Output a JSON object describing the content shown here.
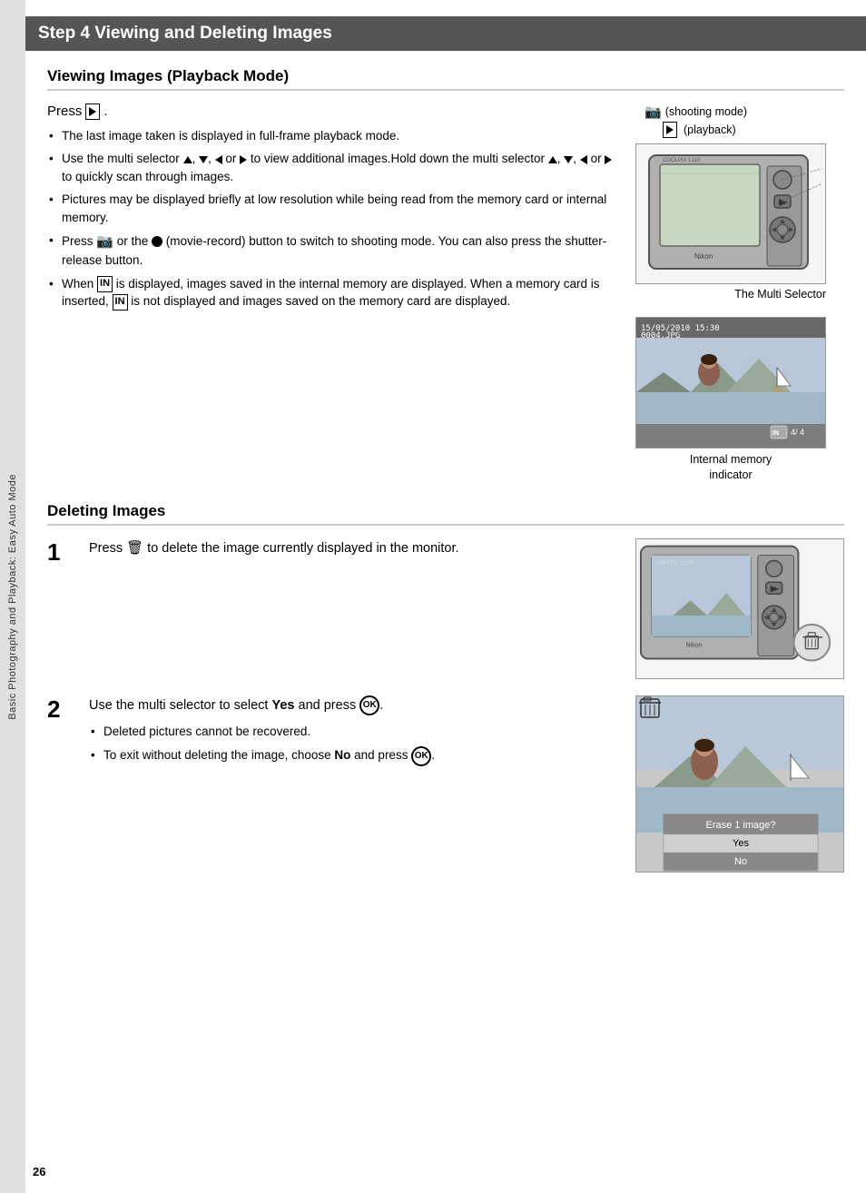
{
  "page_number": "26",
  "sidebar_text": "Basic Photography and Playback: Easy Auto Mode",
  "step_header": "Step 4 Viewing and Deleting Images",
  "section1_header": "Viewing Images (Playback Mode)",
  "press_label": "Press",
  "playback_icon_label": "▶",
  "bullet1": "The last image taken is displayed in full-frame playback mode.",
  "bullet2_pre": "Use the multi selector ",
  "bullet2_icons": "▲, ▼, ◄ or ►",
  "bullet2_mid": " to view additional images.Hold down the multi selector ",
  "bullet2_icons2": "▲, ▼, ◄ or ►",
  "bullet2_post": " to quickly scan through images.",
  "bullet3": "Pictures may be displayed briefly at low resolution while being read from the memory card or internal memory.",
  "bullet4_pre": "Press ",
  "bullet4_post": " or the  (movie-record) button to switch to shooting mode. You can also press the shutter-release button.",
  "bullet5_pre": "When ",
  "bullet5_mid": " is displayed, images saved in the internal memory are displayed. When a memory card is inserted, ",
  "bullet5_post": " is not displayed and images saved on the memory card are displayed.",
  "shooting_mode_label": "(shooting mode)",
  "playback_label": "(playback)",
  "multi_selector_label": "The Multi Selector",
  "memory_timestamp": "15/05/2010 15:30",
  "memory_filename": "0004.JPG",
  "memory_counter": "4/  4",
  "internal_memory_label": "Internal memory\nindicator",
  "section2_header": "Deleting Images",
  "step1_num": "1",
  "step1_text_pre": "Press ",
  "step1_text_post": " to delete the image currently displayed in the monitor.",
  "step2_num": "2",
  "step2_text_pre": "Use the multi selector to select ",
  "step2_bold": "Yes",
  "step2_text_mid": " and press ",
  "step2_subbullet1": "Deleted pictures cannot be recovered.",
  "step2_subbullet2_pre": "To exit without deleting the image, choose ",
  "step2_subbullet2_bold": "No",
  "step2_subbullet2_post": " and press ",
  "erase_dialog_title": "Erase 1 image?",
  "erase_yes": "Yes",
  "erase_no": "No"
}
